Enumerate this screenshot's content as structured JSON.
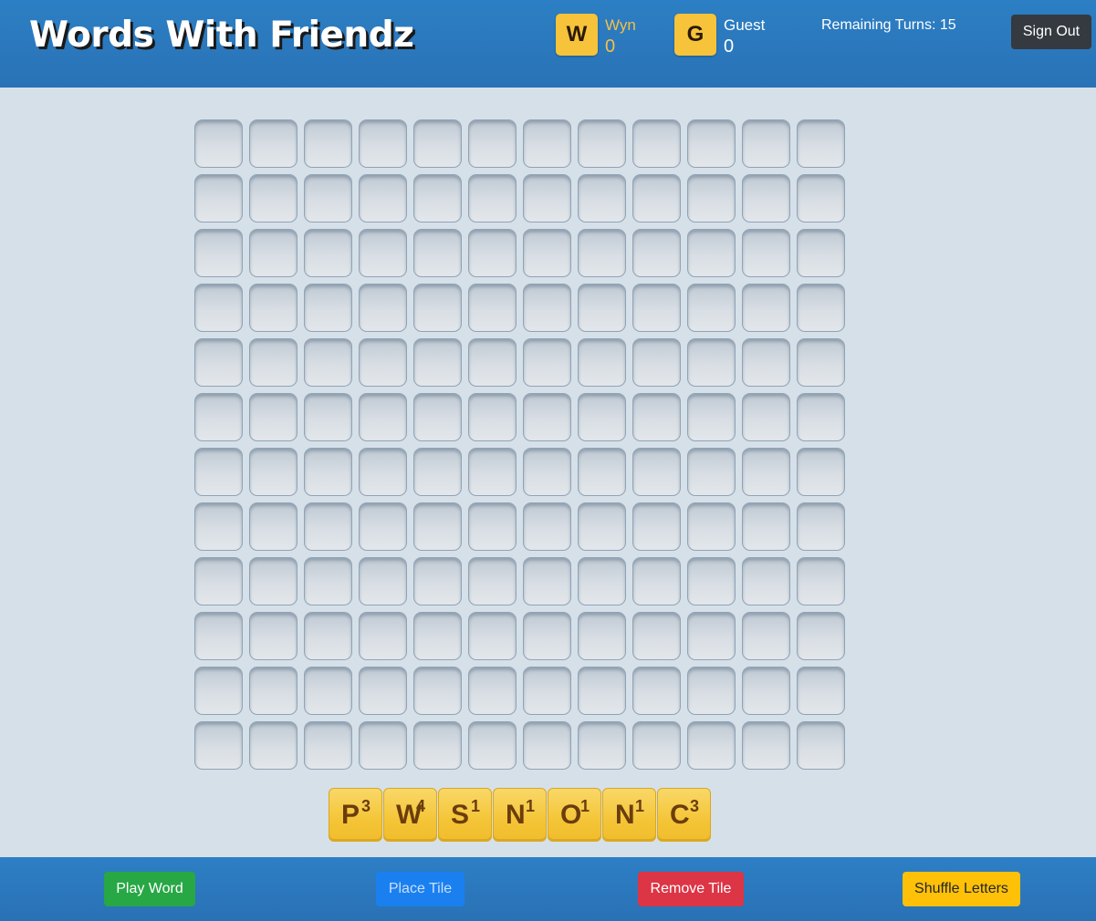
{
  "header": {
    "title": "Words With Friendz",
    "remaining_turns_label": "Remaining Turns: 15",
    "sign_out_label": "Sign Out"
  },
  "players": [
    {
      "initial": "W",
      "name": "Wyn",
      "score": "0",
      "color": "#f3c04a"
    },
    {
      "initial": "G",
      "name": "Guest",
      "score": "0",
      "color": "#ffffff"
    }
  ],
  "board": {
    "rows": 12,
    "cols": 12
  },
  "rack": [
    {
      "letter": "P",
      "points": "3"
    },
    {
      "letter": "W",
      "points": "4"
    },
    {
      "letter": "S",
      "points": "1"
    },
    {
      "letter": "N",
      "points": "1"
    },
    {
      "letter": "O",
      "points": "1"
    },
    {
      "letter": "N",
      "points": "1"
    },
    {
      "letter": "C",
      "points": "3"
    }
  ],
  "footer": {
    "play_word_label": "Play Word",
    "place_tile_label": "Place Tile",
    "remove_tile_label": "Remove Tile",
    "shuffle_letters_label": "Shuffle Letters"
  },
  "colors": {
    "header": "#2a76bc",
    "tile": "#f4c537",
    "play": "#28a745",
    "place": "#1a80f0",
    "remove": "#dc3545",
    "shuffle": "#ffc107"
  }
}
